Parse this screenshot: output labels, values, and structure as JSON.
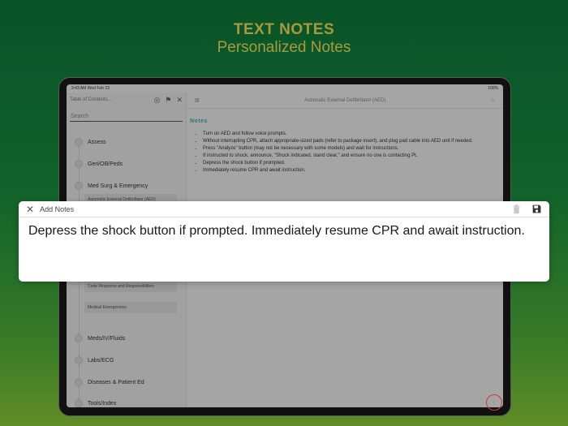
{
  "promo": {
    "title": "TEXT NOTES",
    "subtitle": "Personalized Notes"
  },
  "statusbar": {
    "time_date": "9:43 AM   Wed Feb 23",
    "battery": "100%"
  },
  "sidebar": {
    "header": "Table of Contents...",
    "search_placeholder": "Search",
    "items": [
      {
        "label": "Assess"
      },
      {
        "label": "Geri/OB/Peds"
      },
      {
        "label": "Med Surg & Emergency"
      },
      {
        "label": "Meds/IV/Fluids"
      },
      {
        "label": "Labs/ECG"
      },
      {
        "label": "Diseases & Patient Ed"
      },
      {
        "label": "Tools/Index"
      }
    ],
    "subitems": [
      {
        "label": "Automatic External Defibrillator (AED)"
      },
      {
        "label": "Code Response and Responsibilities"
      },
      {
        "label": "Medical Emergencies"
      }
    ]
  },
  "main": {
    "title": "Automatic External Defibrillator (AED)",
    "notes_heading": "Notes",
    "notes": [
      "Turn on AED and follow voice prompts.",
      "Without interrupting CPR, attach appropriate-sized pads (refer to package insert), and plug pad cable into AED unit if needed.",
      "Press \"Analyze\" button (may not be necessary with some models) and wait for instructions.",
      "If instructed to shock, announce, \"Shock indicated, stand clear,\" and ensure no one is contacting Pt.",
      "Depress the shock button if prompted.",
      "Immediately resume CPR and await instruction."
    ]
  },
  "dialog": {
    "title": "Add Notes",
    "body": "Depress the shock button if prompted. Immediately resume CPR and await instruction."
  },
  "colors": {
    "accent_yellow": "#f2e35c",
    "notes_heading": "#4aa8b8",
    "fab_red": "#c04040"
  }
}
